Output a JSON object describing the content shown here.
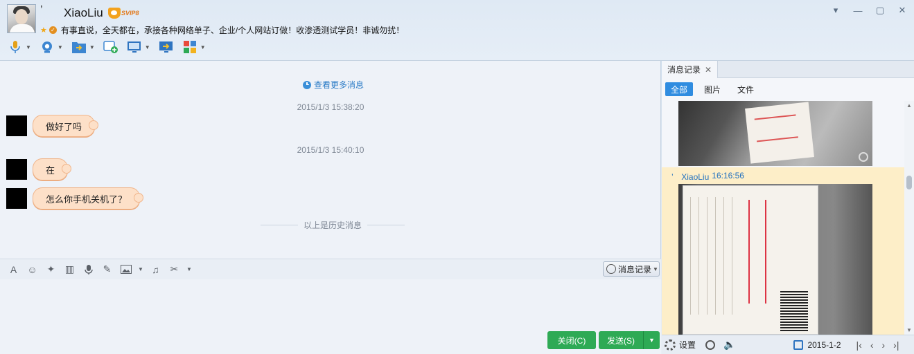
{
  "header": {
    "name_prefix": "’",
    "contact_name": "XiaoLiu",
    "vip_badge": "SVIP8",
    "signature": "有事直说，全天都在，承接各种网络单子、企业/个人网站订做！收渗透测试学员！非诚勿扰！",
    "window_controls": [
      "chevron-down-icon",
      "minimize-icon",
      "maximize-icon",
      "close-icon"
    ]
  },
  "toolbar": {
    "items": [
      "voice-call-icon",
      "video-call-icon",
      "file-transfer-icon",
      "add-group-icon",
      "remote-desktop-icon",
      "screen-share-icon",
      "apps-icon"
    ]
  },
  "chat": {
    "more_link": "查看更多消息",
    "messages": [
      {
        "timestamp": "2015/1/3 15:38:20",
        "text": "做好了吗"
      },
      {
        "timestamp": "2015/1/3 15:40:10",
        "text": "在"
      },
      {
        "timestamp": "",
        "text": "怎么你手机关机了？"
      }
    ],
    "history_divider": "以上是历史消息"
  },
  "editor_toolbar": {
    "icons": [
      "font-icon",
      "emoji-icon",
      "magic-icon",
      "shake-icon",
      "voice-message-icon",
      "edit-icon",
      "image-icon",
      "music-icon",
      "scissors-icon"
    ],
    "history_button": "消息记录"
  },
  "actions": {
    "close_label": "关闭(C)",
    "send_label": "发送(S)"
  },
  "right_panel": {
    "tab_label": "消息记录",
    "filters": [
      "全部",
      "图片",
      "文件"
    ],
    "entry_sender": "’　XiaoLiu",
    "entry_time": "16:16:56",
    "footer": {
      "settings_label": "设置",
      "date": "2015-1-2"
    }
  },
  "colors": {
    "accent": "#2f8ce0",
    "send_green": "#2eaa55",
    "bubble": "#fde0c8",
    "link": "#2a7bc6"
  }
}
